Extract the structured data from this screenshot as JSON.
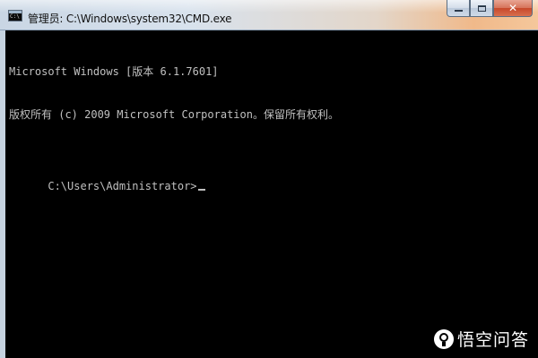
{
  "window": {
    "title": "管理员: C:\\Windows\\system32\\CMD.exe",
    "icon": "cmd-console-icon"
  },
  "caption_buttons": {
    "minimize_icon": "minimize-icon",
    "maximize_icon": "maximize-icon",
    "close_icon": "close-icon",
    "close_glyph": "✕"
  },
  "console": {
    "lines": [
      "Microsoft Windows [版本 6.1.7601]",
      "版权所有 (c) 2009 Microsoft Corporation。保留所有权利。",
      ""
    ],
    "prompt": "C:\\Users\\Administrator>",
    "background_color": "#000000",
    "text_color": "#c0c0c0"
  },
  "watermark": {
    "text": "悟空问答",
    "logo": "wukong-logo"
  }
}
